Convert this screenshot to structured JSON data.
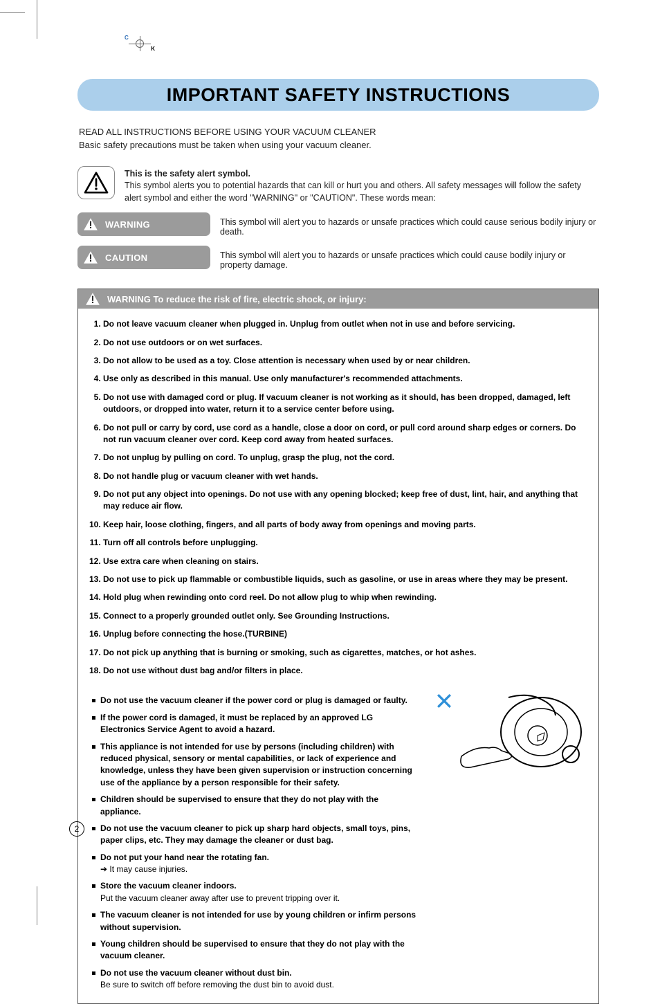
{
  "print_mark": {
    "c": "C",
    "k": "K"
  },
  "title": "IMPORTANT SAFETY INSTRUCTIONS",
  "intro": "READ ALL INSTRUCTIONS BEFORE USING YOUR VACUUM CLEANER\nBasic safety precautions must be taken when using your vacuum cleaner.",
  "symbol_def": {
    "strong": "This is the safety alert symbol.",
    "rest": "This symbol alerts you to potential hazards that can kill or hurt you and others. All safety messages will follow the safety alert symbol and either the word \"WARNING\" or \"CAUTION\". These words mean:"
  },
  "badges": {
    "warning": {
      "label": "WARNING",
      "desc": "This symbol will alert you to hazards or unsafe practices which could cause serious bodily injury or death."
    },
    "caution": {
      "label": "CAUTION",
      "desc": "This symbol will alert you to hazards or unsafe practices which could cause bodily injury or property damage."
    }
  },
  "panel": {
    "header": "WARNING  To reduce the risk of fire, electric shock, or injury:",
    "numbered": [
      {
        "main": "Do not leave vacuum cleaner when plugged in. Unplug from outlet when not in use and before servicing."
      },
      {
        "main": "Do not use outdoors or on wet surfaces."
      },
      {
        "main": "Do not allow to be used as a toy. Close attention is necessary when used by or near children."
      },
      {
        "main": "Use only as described in this manual. Use only manufacturer's recommended attachments."
      },
      {
        "main": "Do not use with damaged cord or plug. If vacuum cleaner is not working as it should, has been dropped, damaged, left outdoors, or dropped into water, return it to a service center before using."
      },
      {
        "main": "Do not pull or carry by cord, use cord as a handle, close a door on cord, or pull cord around sharp edges or corners. Do not run vacuum cleaner over cord. Keep cord away from heated surfaces."
      },
      {
        "main": "Do not unplug by pulling on cord. To unplug, grasp the plug, not the cord."
      },
      {
        "main": "Do not handle plug or vacuum cleaner with wet hands."
      },
      {
        "main": "Do not put any object into openings. Do not use with any opening blocked; keep free of dust, lint, hair, and anything that may reduce air flow."
      },
      {
        "main": "Keep hair, loose clothing, fingers, and all parts of body away from openings and moving parts."
      },
      {
        "main": "Turn off all controls before unplugging."
      },
      {
        "main": "Use extra care when cleaning on stairs."
      },
      {
        "main": "Do not use to pick up flammable or combustible liquids, such as gasoline, or use in areas where they may be present."
      },
      {
        "main": "Hold plug when rewinding onto cord reel. Do not allow plug to whip when rewinding."
      },
      {
        "main": "Connect to a properly grounded outlet only. See Grounding Instructions."
      },
      {
        "main": "Unplug before connecting the hose.(TURBINE)"
      },
      {
        "main": "Do not pick up anything that is burning or smoking, such as cigarettes, matches, or hot ashes."
      },
      {
        "main": "Do not use without dust bag and/or filters in place."
      }
    ],
    "bullets": [
      {
        "main": "Do not use the vacuum cleaner if the power cord or plug is damaged or faulty."
      },
      {
        "main": "If the power cord is damaged, it must be replaced by an approved LG Electronics Service Agent to avoid a hazard."
      },
      {
        "main": "This appliance is not intended for use by persons (including children) with reduced physical, sensory or mental capabilities, or lack of experience and knowledge, unless they have been given supervision or instruction concerning use of the appliance by a person responsible for their safety."
      },
      {
        "main": "Children should be supervised to ensure that they do not play with the appliance."
      },
      {
        "main": "Do not use the vacuum cleaner to pick up sharp hard objects, small toys, pins, paper clips, etc. They may damage the cleaner or dust bag."
      },
      {
        "main": "Do not put your hand near the rotating fan.",
        "sub": "➔ It may cause injuries."
      },
      {
        "main": "Store the vacuum cleaner indoors.",
        "sub": "Put the vacuum cleaner away after use to prevent tripping over it."
      },
      {
        "main": "The vacuum cleaner is not intended for use by young children or infirm persons without supervision."
      },
      {
        "main": "Young children should be supervised to ensure that they do not play with the vacuum cleaner."
      },
      {
        "main": "Do not use the vacuum cleaner without dust bin.",
        "sub": "Be sure to switch off before removing the dust bin to avoid dust."
      }
    ]
  },
  "page_number": "2"
}
